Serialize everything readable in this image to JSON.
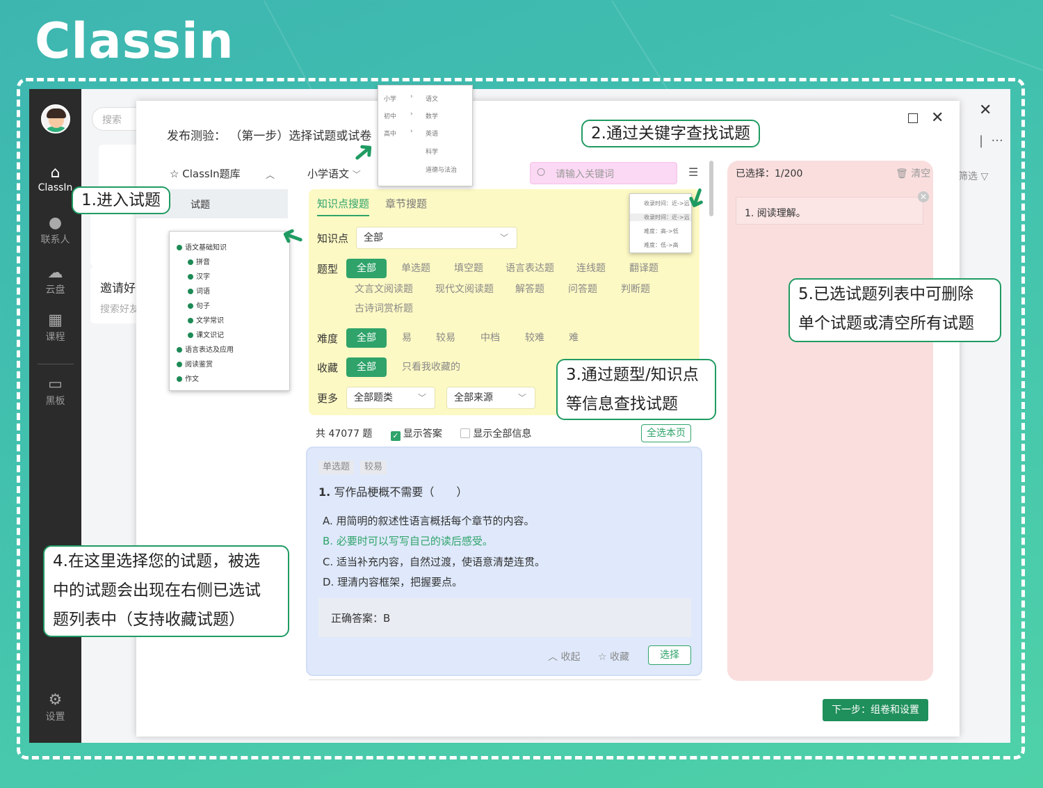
{
  "brand": {
    "logo": "Classin"
  },
  "nav": {
    "items": [
      {
        "label": "ClassIn",
        "icon": "home-icon"
      },
      {
        "label": "联系人",
        "icon": "contact-icon"
      },
      {
        "label": "云盘",
        "icon": "cloud-icon"
      },
      {
        "label": "课程",
        "icon": "calendar-icon"
      },
      {
        "label": "黑板",
        "icon": "blackboard-icon"
      },
      {
        "label": "设置",
        "icon": "settings-icon"
      }
    ]
  },
  "background_app": {
    "search_placeholder": "搜索",
    "invite_title": "邀请好",
    "invite_sub": "搜索好友",
    "filter_label": "筛选"
  },
  "modal": {
    "title": "发布测验： （第一步）选择试题或试卷",
    "bank_label": "ClassIn题库",
    "side_item": "试题",
    "subject": "小学语文",
    "search_placeholder": "请输入关键词",
    "tabs": [
      "知识点搜题",
      "章节搜题"
    ],
    "filters": {
      "knowledge_label": "知识点",
      "knowledge_value": "全部",
      "type_label": "题型",
      "type_options": [
        "全部",
        "单选题",
        "填空题",
        "语言表达题",
        "连线题",
        "翻译题",
        "文言文阅读题",
        "现代文阅读题",
        "解答题",
        "问答题",
        "判断题",
        "古诗词赏析题"
      ],
      "difficulty_label": "难度",
      "difficulty_options": [
        "全部",
        "易",
        "较易",
        "中档",
        "较难",
        "难"
      ],
      "fav_label": "收藏",
      "fav_options": [
        "全部",
        "只看我收藏的"
      ],
      "more_label": "更多",
      "more_selects": [
        "全部题类",
        "全部来源"
      ]
    },
    "count_text": "共 47077 题",
    "show_answer": "显示答案",
    "show_all_info": "显示全部信息",
    "select_page": "全选本页",
    "question": {
      "tags": [
        "单选题",
        "较易"
      ],
      "number": "1.",
      "stem": "写作品梗概不需要（　　）",
      "options": [
        "A. 用简明的叙述性语言概括每个章节的内容。",
        "B. 必要时可以写写自己的读后感受。",
        "C. 适当补充内容，自然过渡，使语意清楚连贯。",
        "D. 理清内容框架，把握要点。"
      ],
      "answer": "正确答案：B",
      "fold": "收起",
      "fav": "收藏",
      "choose": "选择"
    },
    "selected_count": "已选择：1/200",
    "clear": "清空",
    "selected_item": "1. 阅读理解。",
    "next": "下一步：组卷和设置"
  },
  "grade_popup": {
    "grades": [
      "小学",
      "初中",
      "高中"
    ],
    "subjects": [
      "语文",
      "数学",
      "英语",
      "科学",
      "道德与法治"
    ]
  },
  "tree_popup": {
    "items": [
      {
        "label": "语文基础知识",
        "level": 0
      },
      {
        "label": "拼音",
        "level": 1
      },
      {
        "label": "汉字",
        "level": 1
      },
      {
        "label": "词语",
        "level": 1
      },
      {
        "label": "句子",
        "level": 1
      },
      {
        "label": "文学常识",
        "level": 1
      },
      {
        "label": "课文识记",
        "level": 1
      },
      {
        "label": "语言表达及应用",
        "level": 0
      },
      {
        "label": "阅读鉴赏",
        "level": 0
      },
      {
        "label": "作文",
        "level": 0
      }
    ]
  },
  "sort_popup": {
    "items": [
      "收录时间：近->远",
      "收录时间：近->远",
      "难度：高->低",
      "难度：低->高"
    ]
  },
  "callouts": {
    "c1": "1.进入试题",
    "c2": "2.通过关键字查找试题",
    "c3_line1": "3.通过题型/知识点",
    "c3_line2": "等信息查找试题",
    "c4_line1": "4.在这里选择您的试题，被选",
    "c4_line2": "中的试题会出现在右侧已选试",
    "c4_line3": "题列表中（支持收藏试题）",
    "c5_line1": "5.已选试题列表中可删除",
    "c5_line2": "单个试题或清空所有试题"
  },
  "colors": {
    "brand_green": "#2fa36a",
    "filter_bg": "#fdf9c4",
    "question_bg": "#dfe9fb",
    "selected_bg": "#fadede",
    "search_bg": "#fbd8f3"
  }
}
